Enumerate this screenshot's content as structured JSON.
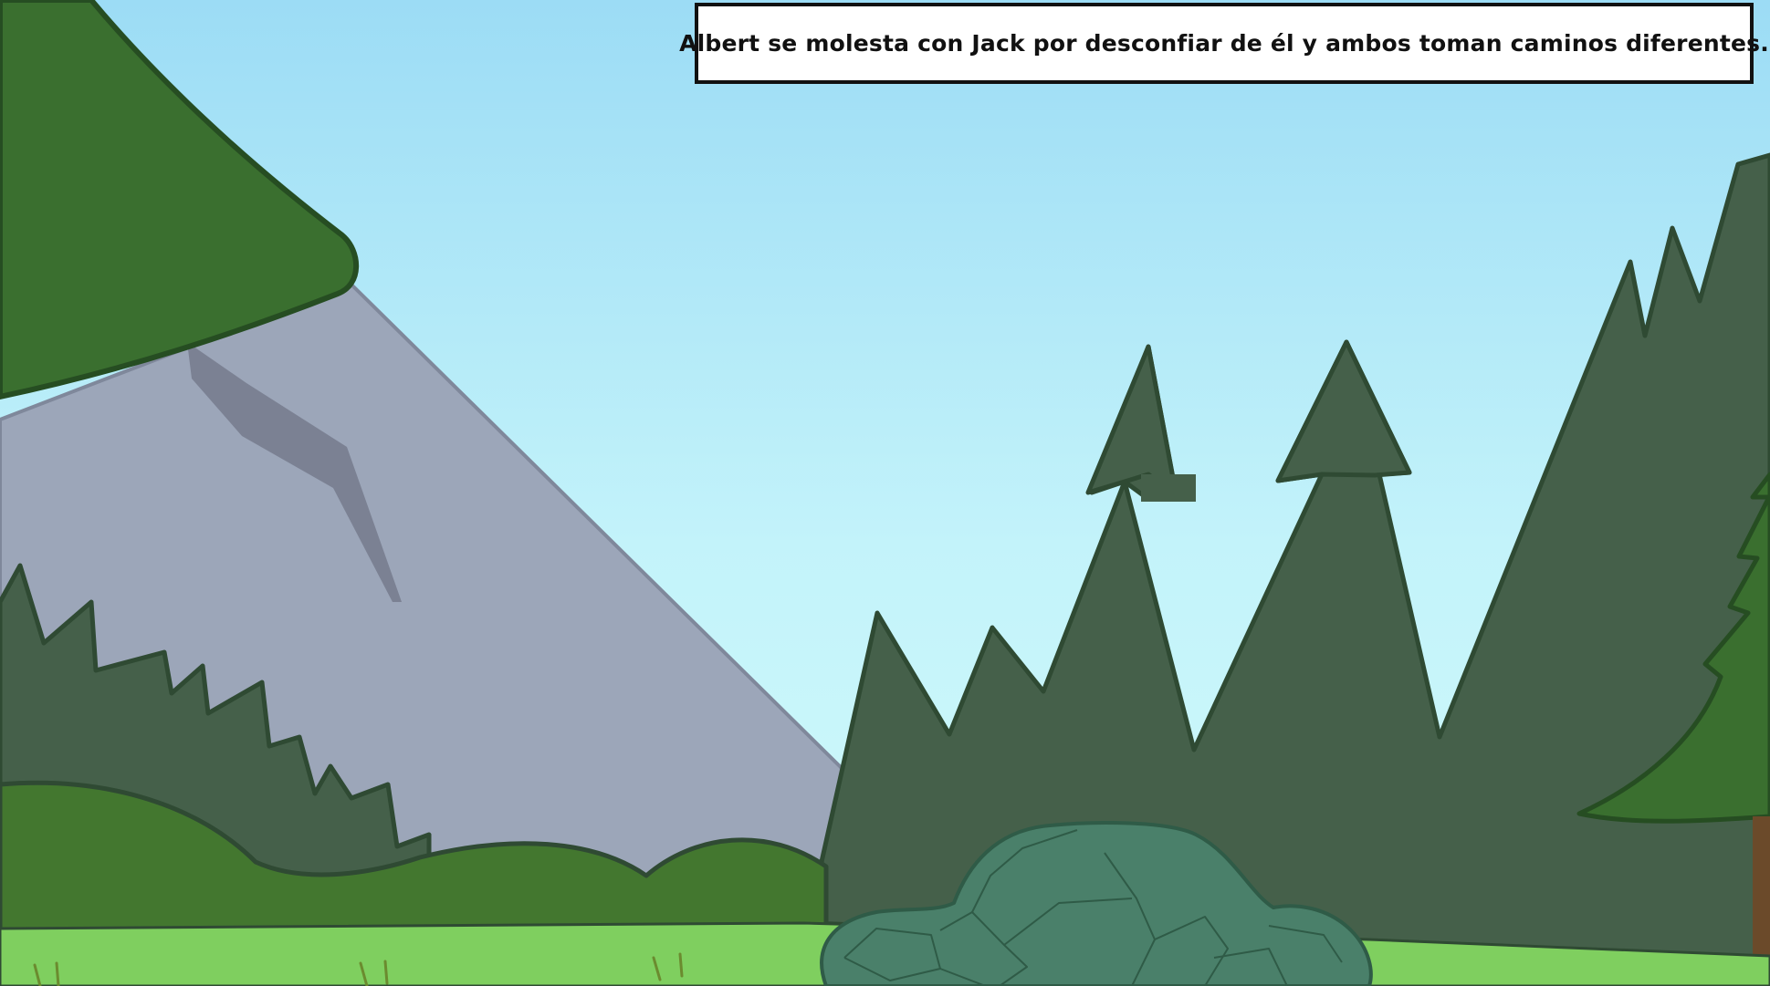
{
  "caption": {
    "text": "Albert se molesta con Jack por desconfiar de él y ambos toman caminos diferentes."
  },
  "colors": {
    "sky_top": "#9cdcf5",
    "sky_bottom": "#cdf8fb",
    "mountain": "#9ca6b9",
    "mountain_shadow": "#7b8193",
    "dark_forest": "#45604a",
    "outline": "#2f4a33",
    "hill_green": "#43772f",
    "tree_green": "#3a6f2f",
    "tree_outline": "#264d22",
    "grass": "#7fcf5f",
    "bush": "#4a806a",
    "bush_outline": "#2f5b47",
    "grass_tufts": "#6b8b2f",
    "caption_border": "#111111"
  }
}
